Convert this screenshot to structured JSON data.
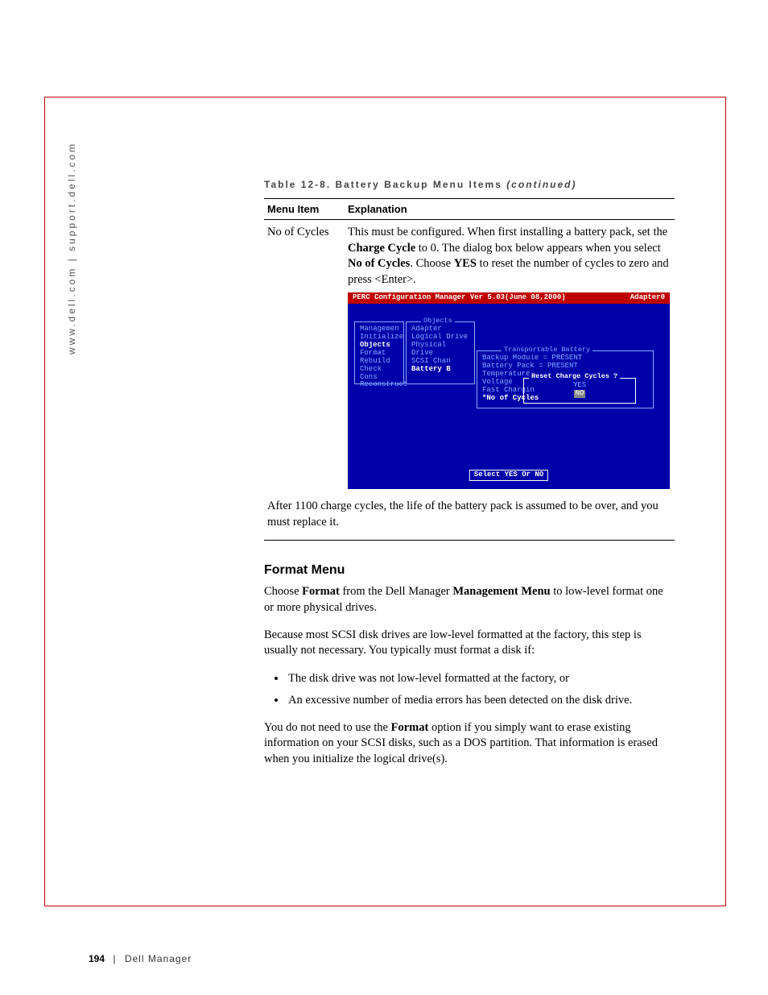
{
  "side_url": "www.dell.com | support.dell.com",
  "table": {
    "caption_prefix": "Table 12-8. Battery Backup Menu Items ",
    "caption_suffix": "(continued)",
    "headers": {
      "c1": "Menu Item",
      "c2": "Explanation"
    },
    "row": {
      "item": "No of Cycles",
      "exp_p1a": "This must be configured. When first installing a battery pack, set the ",
      "exp_p1b": "Charge Cycle",
      "exp_p1c": " to 0. The dialog box below appears when you select ",
      "exp_p1d": "No of Cycles",
      "exp_p1e": ". Choose ",
      "exp_p1f": "YES",
      "exp_p1g": " to reset the number of cycles to zero and press <Enter>.",
      "after": "After 1100 charge cycles, the life of the battery pack is assumed to be over, and you must replace it."
    }
  },
  "screenshot": {
    "title_left": "PERC Configuration Manager  Ver 5.03(June 08,2000)",
    "title_right": "Adapter0",
    "menu1": [
      "Managemen",
      "Initialize",
      "Objects",
      "Format",
      "Rebuild",
      "Check Cons",
      "Reconstruct"
    ],
    "menu1_title": "",
    "menu2_title": "Objects",
    "menu2": [
      "Adapter",
      "Logical Drive",
      "Physical Drive",
      "SCSI Chan",
      "Battery B"
    ],
    "menu3_title": "Transportable Battery",
    "menu3": [
      "Backup Module = PRESENT",
      "Battery Pack  = PRESENT",
      "Temperature",
      "Voltage",
      "Fast Chargin",
      "*No of Cycles"
    ],
    "menu4_title": "Reset Charge Cycles ?",
    "menu4_yes": "YES",
    "menu4_no": "NO",
    "hint": "Select YES Or NO"
  },
  "section": {
    "head": "Format Menu",
    "p1a": "Choose ",
    "p1b": "Format",
    "p1c": " from the Dell Manager ",
    "p1d": "Management Menu",
    "p1e": " to low-level format one or more physical drives.",
    "p2": "Because most SCSI disk drives are low-level formatted at the factory, this step is usually not necessary. You typically must format a disk if:",
    "b1": "The disk drive was not low-level formatted at the factory, or",
    "b2": "An excessive number of media errors has been detected on the disk drive.",
    "p3a": "You do not need to use the ",
    "p3b": "Format",
    "p3c": " option if you simply want to erase existing information on your SCSI disks, such as a DOS partition. That information is erased when you initialize the logical drive(s)."
  },
  "footer": {
    "page": "194",
    "sep": "|",
    "title": "Dell Manager"
  }
}
